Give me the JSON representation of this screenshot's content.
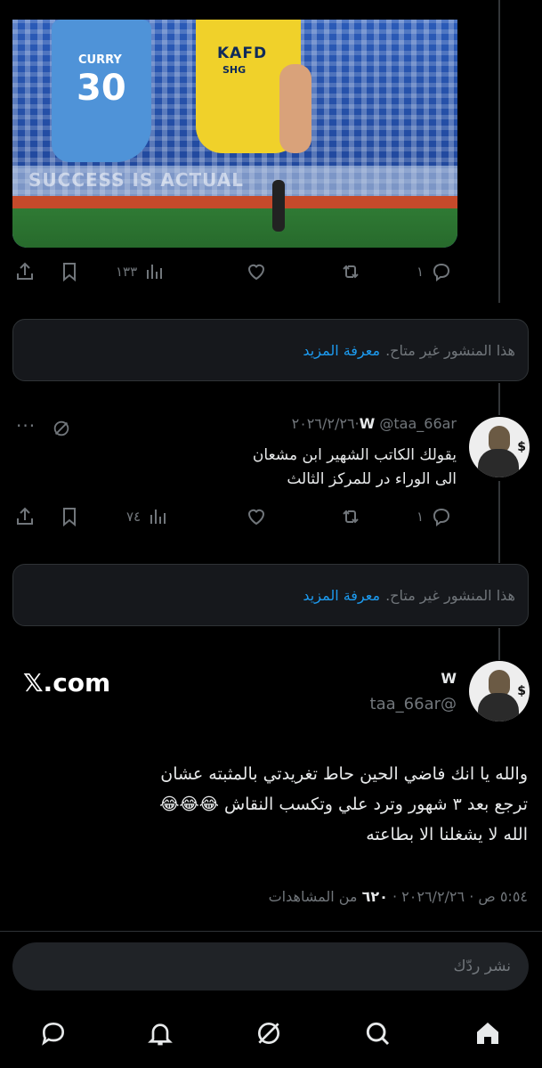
{
  "media": {
    "jersey_name": "CURRY",
    "jersey_number": "30",
    "sponsor": "KAFD",
    "sponsor_sub": "SHG",
    "banner_text": "SUCCESS IS ACTUAL"
  },
  "post1_actions": {
    "replies": "١",
    "views": "١٣٣"
  },
  "unavailable": {
    "text": "هذا المنشور غير متاح.",
    "link": "معرفة المزيد"
  },
  "tweet2": {
    "name": "W",
    "handle": "@taa_66ar",
    "date": "٢٠٢٦/٢/٢٦",
    "lines": [
      "يقولك الكاتب الشهير ابن مشعان",
      "الى الوراء در للمركز الثالث"
    ],
    "replies": "١",
    "views": "٧٤"
  },
  "unavailable2": {
    "text": "هذا المنشور غير متاح.",
    "link": "معرفة المزيد"
  },
  "focused": {
    "site": "𝕏.com",
    "name": "W",
    "handle": "@taa_66ar",
    "lines": [
      "والله يا انك فاضي الحين حاط تغريدتي بالمثبته عشان",
      "ترجع بعد ٣ شهور وترد علي وتكسب النقاش 😂😂😂",
      "الله لا يشغلنا الا بطاعته"
    ],
    "time": "٥:٥٤ ص",
    "date": "٢٠٢٦/٢/٢٦",
    "views_count": "٦٢٠",
    "views_label": "من المشاهدات"
  },
  "reply_placeholder": "نشر ردّك",
  "icons": [
    "share-icon",
    "bookmark-icon",
    "views-icon",
    "like-icon",
    "retweet-icon",
    "reply-icon",
    "grok-icon",
    "more-icon",
    "messages-icon",
    "notifications-icon",
    "search-icon",
    "home-icon"
  ]
}
